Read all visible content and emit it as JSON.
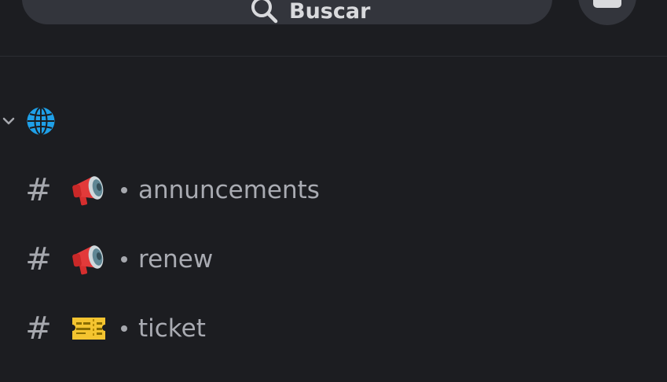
{
  "search": {
    "label": "Buscar"
  },
  "category": {
    "icon": "globe-icon"
  },
  "channels": [
    {
      "prefix": "#",
      "emoji": "megaphone-icon",
      "name": "annuncements"
    },
    {
      "prefix": "#",
      "emoji": "megaphone-icon",
      "name": "renew"
    },
    {
      "prefix": "#",
      "emoji": "ticket-icon",
      "name": "ticket"
    }
  ],
  "colors": {
    "background": "#1c1d21",
    "search_background": "#33353c",
    "channel_text": "#a9abb2"
  }
}
